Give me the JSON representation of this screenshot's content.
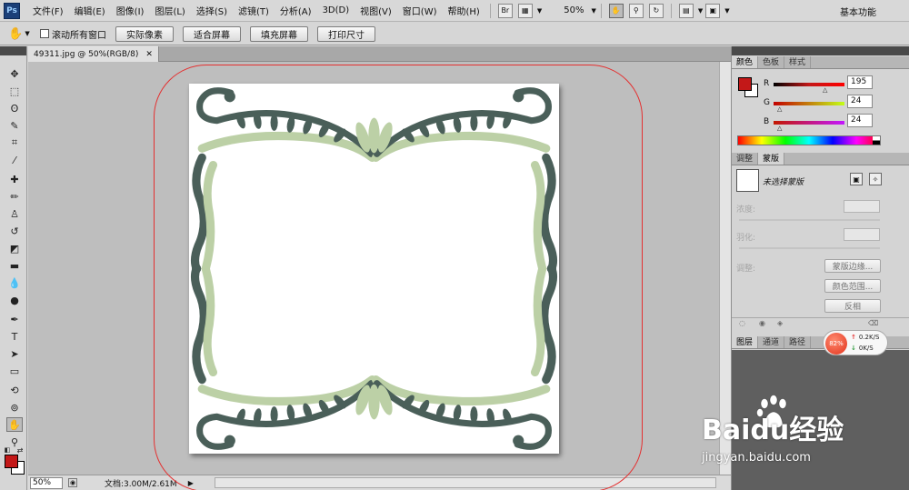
{
  "app": {
    "logo": "Ps",
    "menu": [
      "文件(F)",
      "编辑(E)",
      "图像(I)",
      "图层(L)",
      "选择(S)",
      "滤镜(T)",
      "分析(A)",
      "3D(D)",
      "视图(V)",
      "窗口(W)",
      "帮助(H)"
    ],
    "bridge_label": "Br",
    "zoom": "50%",
    "workspace": "基本功能"
  },
  "options": {
    "scroll_all_windows": "滚动所有窗口",
    "scroll_all_checked": false,
    "actual_pixels": "实际像素",
    "fit_screen": "适合屏幕",
    "fill_screen": "填充屏幕",
    "print_size": "打印尺寸"
  },
  "document": {
    "tab_title": "49311.jpg @ 50%(RGB/8)",
    "zoom_field": "50%",
    "doc_info": "文档:3.00M/2.61M"
  },
  "colors": {
    "foreground": "#c31818",
    "background": "#ffffff",
    "ornament_dark": "#4a5f59",
    "ornament_light": "#bcd0a6",
    "annotation": "#e43030"
  },
  "color_panel": {
    "tabs": [
      "颜色",
      "色板",
      "样式"
    ],
    "channels": [
      {
        "label": "R",
        "value": "195"
      },
      {
        "label": "G",
        "value": "24"
      },
      {
        "label": "B",
        "value": "24"
      }
    ]
  },
  "adjust_panel": {
    "tabs": [
      "调整",
      "蒙版"
    ],
    "mask_title": "未选择蒙版",
    "density_label": "浓度:",
    "feather_label": "羽化:",
    "refine_label": "调整:",
    "mask_edge_button": "蒙版边缘...",
    "color_range_button": "颜色范围...",
    "invert_button": "反相"
  },
  "layers_panel": {
    "tabs": [
      "图层",
      "通道",
      "路径"
    ]
  },
  "network_widget": {
    "percent": "82%",
    "up": "0.2K/S",
    "down": "0K/S"
  },
  "watermark": {
    "brand": "Baidu经验",
    "url": "jingyan.baidu.com"
  }
}
